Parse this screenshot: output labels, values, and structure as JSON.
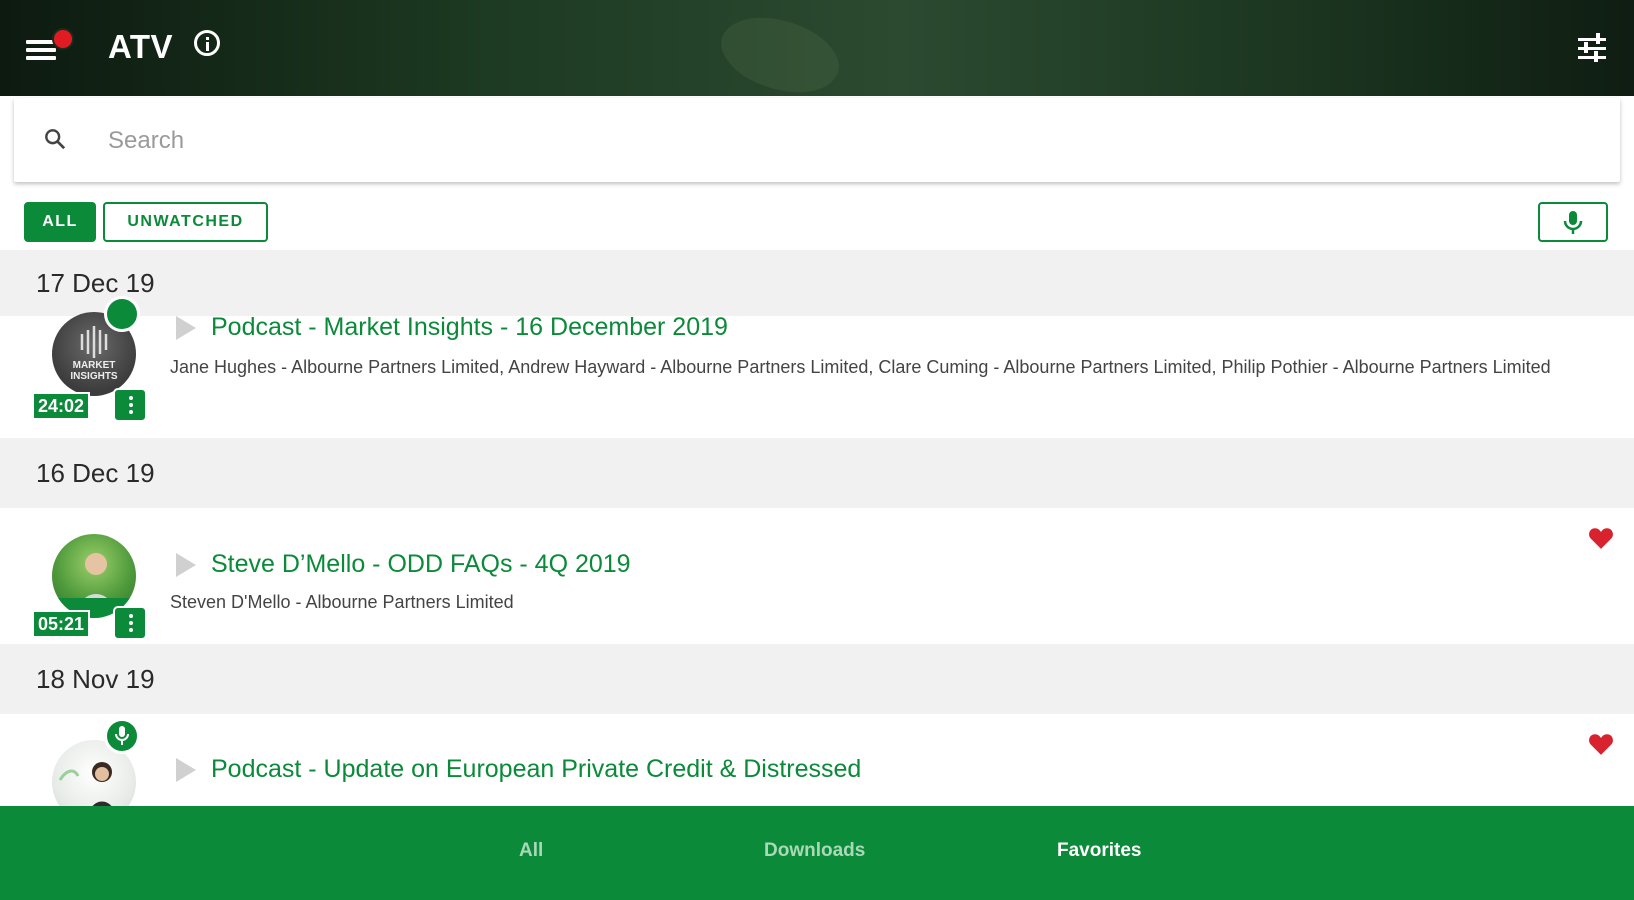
{
  "header": {
    "app_title": "ATV",
    "menu_icon": "hamburger-menu-icon",
    "info_icon": "info-icon",
    "filter_icon": "sliders-icon",
    "notification_dot_color": "#e11b22"
  },
  "search": {
    "placeholder": "Search",
    "value": ""
  },
  "filters": {
    "all_label": "ALL",
    "unwatched_label": "UNWATCHED",
    "selected": "ALL",
    "mic_filter_icon": "microphone-icon"
  },
  "feed": [
    {
      "date": "17 Dec 19",
      "items": [
        {
          "title": "Podcast - Market Insights - 16 December 2019",
          "authors": "Jane Hughes - Albourne Partners Limited, Andrew Hayward - Albourne Partners Limited, Clare Cuming - Albourne Partners Limited, Philip Pothier - Albourne Partners Limited",
          "duration": "24:02",
          "thumbnail_text": "MARKET INSIGHTS",
          "favorite": false
        }
      ]
    },
    {
      "date": "16 Dec 19",
      "items": [
        {
          "title": "Steve D’Mello - ODD FAQs - 4Q 2019",
          "authors": "Steven D'Mello - Albourne Partners Limited",
          "duration": "05:21",
          "favorite": true
        }
      ]
    },
    {
      "date": "18 Nov 19",
      "items": [
        {
          "title": "Podcast - Update on European Private Credit & Distressed",
          "authors": "",
          "favorite": true,
          "badge_icon": "microphone-icon"
        }
      ]
    }
  ],
  "bottom_nav": {
    "tabs": [
      "All",
      "Downloads",
      "Favorites"
    ],
    "active": "Favorites"
  },
  "colors": {
    "accent": "#0b8a3a",
    "favorite": "#d8232e",
    "date_header_bg": "#f1f1f1"
  }
}
